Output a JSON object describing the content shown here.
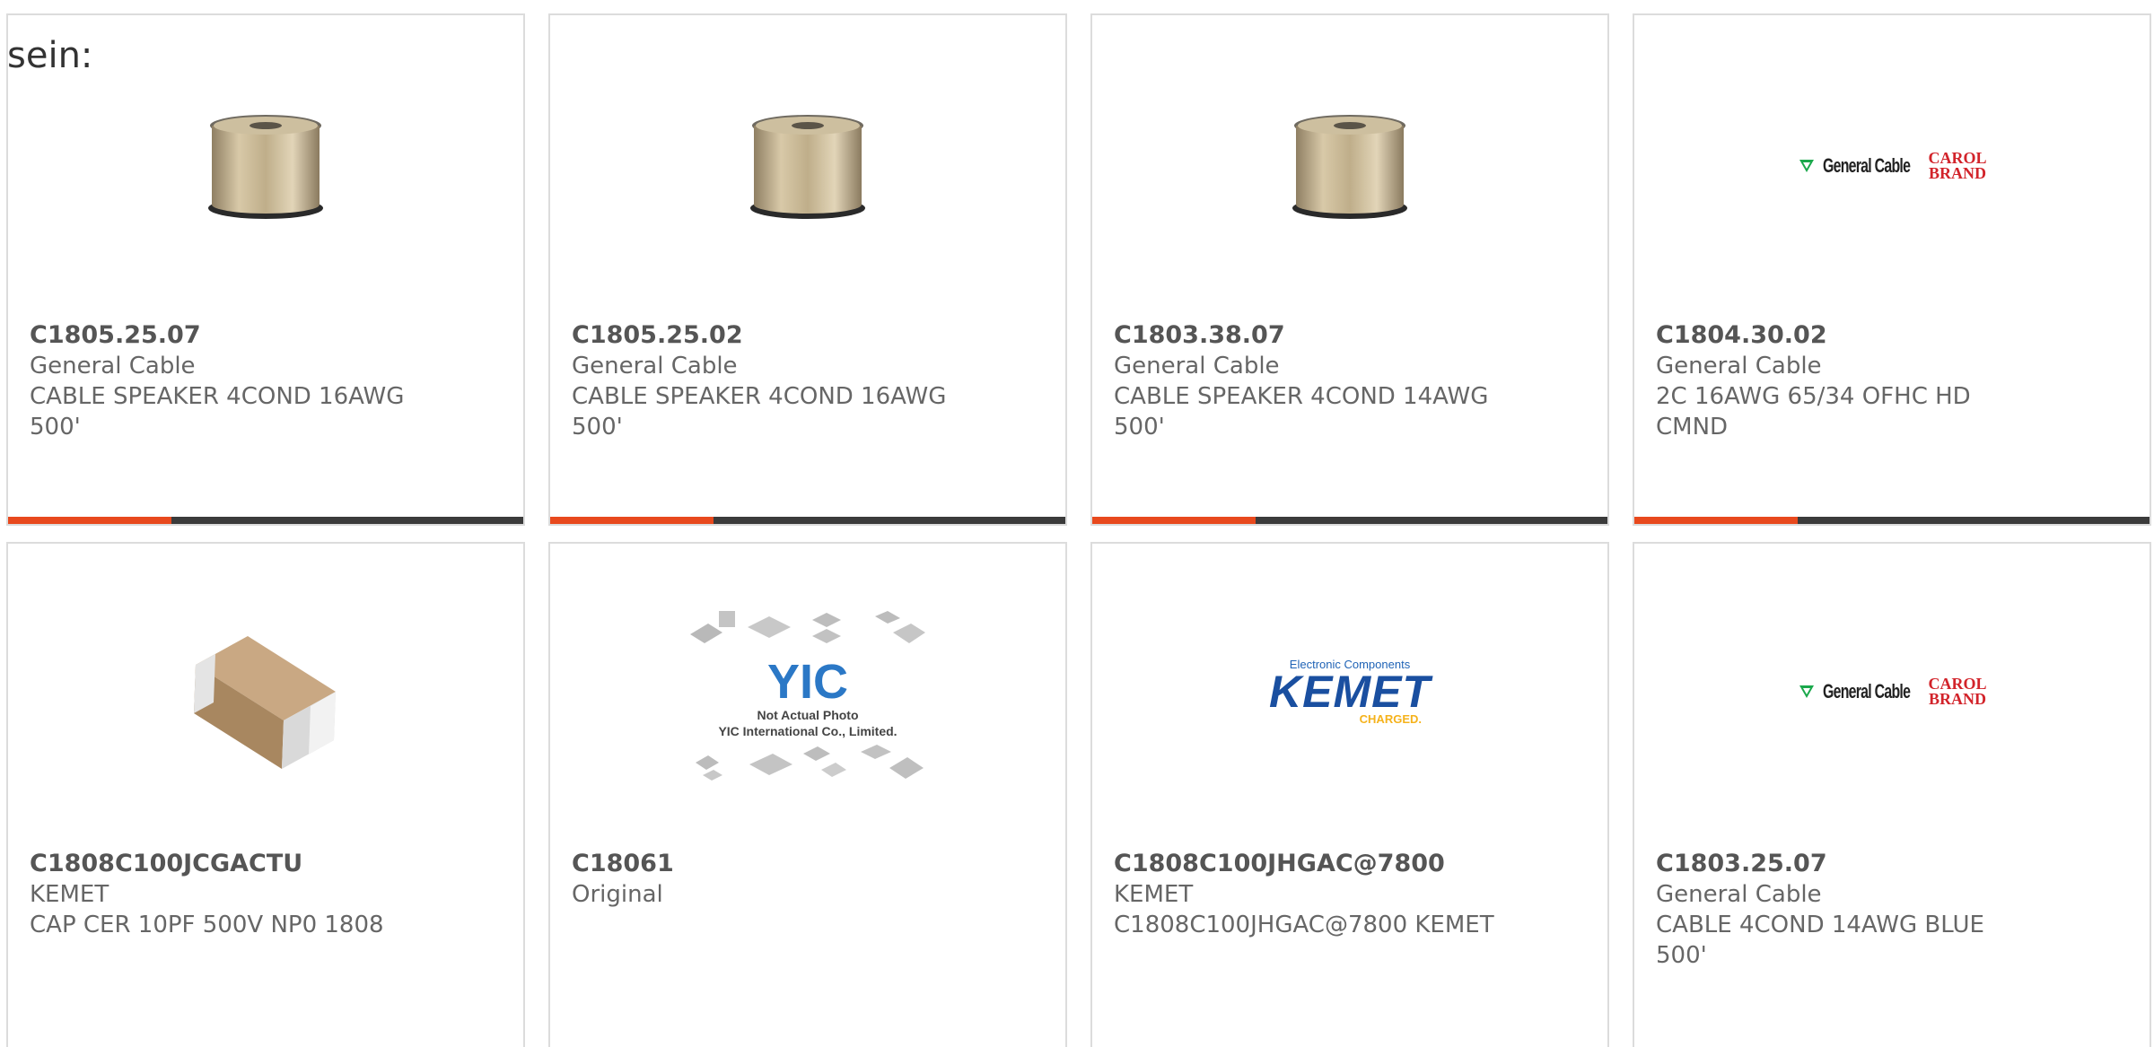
{
  "heading": "sein:",
  "colors": {
    "accent": "#e8491d",
    "bar": "#3b3b3b",
    "border": "#dcdcdc",
    "text": "#666666"
  },
  "products": [
    {
      "part": "C1805.25.07",
      "manufacturer": "General Cable",
      "description": "CABLE SPEAKER 4COND 16AWG 500'",
      "image": "cable-spool"
    },
    {
      "part": "C1805.25.02",
      "manufacturer": "General Cable",
      "description": "CABLE SPEAKER 4COND 16AWG 500'",
      "image": "cable-spool"
    },
    {
      "part": "C1803.38.07",
      "manufacturer": "General Cable",
      "description": "CABLE SPEAKER 4COND 14AWG 500'",
      "image": "cable-spool"
    },
    {
      "part": "C1804.30.02",
      "manufacturer": "General Cable",
      "description": "2C 16AWG 65/34 OFHC HD CMND",
      "image": "general-cable-logo"
    },
    {
      "part": "C1808C100JCGACTU",
      "manufacturer": "KEMET",
      "description": "CAP CER 10PF 500V NP0 1808",
      "image": "ceramic-capacitor"
    },
    {
      "part": "C18061",
      "manufacturer": "Original",
      "description": "",
      "image": "yic-placeholder"
    },
    {
      "part": "C1808C100JHGAC@7800",
      "manufacturer": "KEMET",
      "description": "C1808C100JHGAC@7800 KEMET",
      "image": "kemet-logo"
    },
    {
      "part": "C1803.25.07",
      "manufacturer": "General Cable",
      "description": "CABLE 4COND 14AWG BLUE 500'",
      "image": "general-cable-logo"
    }
  ],
  "logos": {
    "general_cable": "General Cable",
    "carol_line1": "CAROL",
    "carol_line2": "BRAND",
    "kemet_top": "Electronic Components",
    "kemet_name": "KEMET",
    "kemet_bottom": "CHARGED.",
    "yic_mark": "YIC",
    "yic_caption1": "Not Actual Photo",
    "yic_caption2": "YIC International Co., Limited."
  }
}
